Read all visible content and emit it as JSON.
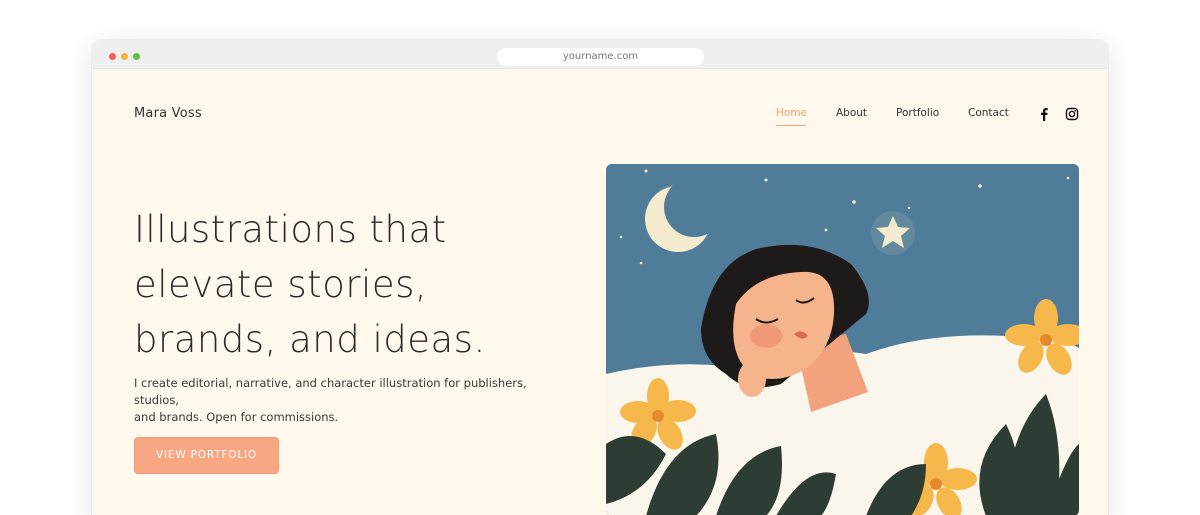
{
  "browser": {
    "url": "yourname.com"
  },
  "site": {
    "logo": "Mara Voss",
    "nav": [
      {
        "label": "Home",
        "active": true
      },
      {
        "label": "About",
        "active": false
      },
      {
        "label": "Portfolio",
        "active": false
      },
      {
        "label": "Contact",
        "active": false
      }
    ],
    "social": [
      "facebook-icon",
      "instagram-icon"
    ],
    "accent_color": "#f8a783"
  },
  "hero": {
    "headline_lines": [
      "Illustrations that",
      "elevate stories,",
      "brands, and ideas."
    ],
    "subtext_lines": [
      "I create editorial, narrative, and character illustration for publishers, studios,",
      "and brands. Open for commissions."
    ],
    "cta_label": "VIEW PORTFOLIO"
  },
  "illustration": {
    "subject": "sleeping-woman-night-sky-flowers",
    "colors": {
      "sky": "#4f7c98",
      "moon": "#f4ebcf",
      "skin": "#f6b48c",
      "hair": "#1f1a1a",
      "blanket": "#fbf6ec",
      "flower": "#f7b84b",
      "leaf": "#2e3d33"
    }
  }
}
